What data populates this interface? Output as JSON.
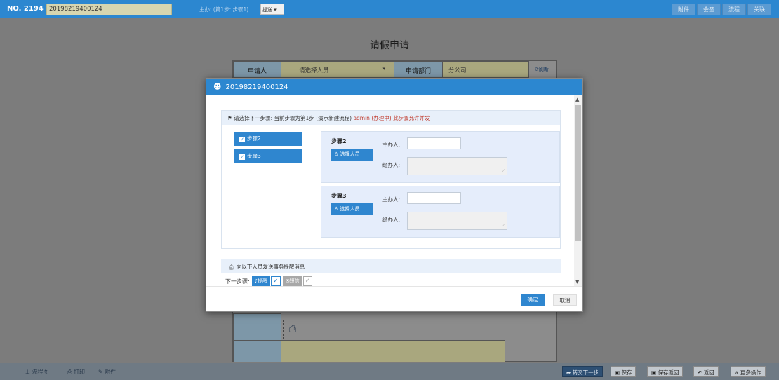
{
  "topbar": {
    "no_label": "NO. 2194",
    "doc_number": "20198219400124",
    "step_text": "主办: (第1步: 步骤1)",
    "step_select": "提送",
    "buttons": [
      "附件",
      "会签",
      "流程",
      "关联"
    ]
  },
  "form": {
    "title": "请假申请",
    "applicant_label": "申请人",
    "applicant_select": "请选择人员",
    "dept_label": "申请部门",
    "dept_value": "分公司",
    "refresh": "刷新"
  },
  "modal": {
    "title": "20198219400124",
    "section1": {
      "header_prefix": "请选择下一步骤: 当前步骤为第1步 (演示新建流程)",
      "admin": "admin (办理中)",
      "warn": "此步骤允许并发"
    },
    "checks": [
      "步骤2",
      "步骤3"
    ],
    "panels": [
      {
        "title": "步骤2",
        "btn": "选择人员",
        "label1": "主办人:",
        "label2": "经办人:"
      },
      {
        "title": "步骤3",
        "btn": "选择人员",
        "label1": "主办人:",
        "label2": "经办人:"
      }
    ],
    "section2": {
      "header": "向以下人员发送事务提醒消息",
      "next_label": "下一步骤:",
      "tag_remind": "提醒",
      "tag_sms": "短信"
    },
    "ok": "确定",
    "cancel": "取消"
  },
  "bottombar": {
    "left": [
      "流程图",
      "打印",
      "附件"
    ],
    "right": [
      "转交下一步",
      "保存",
      "保存返回",
      "返回",
      "更多操作"
    ]
  }
}
